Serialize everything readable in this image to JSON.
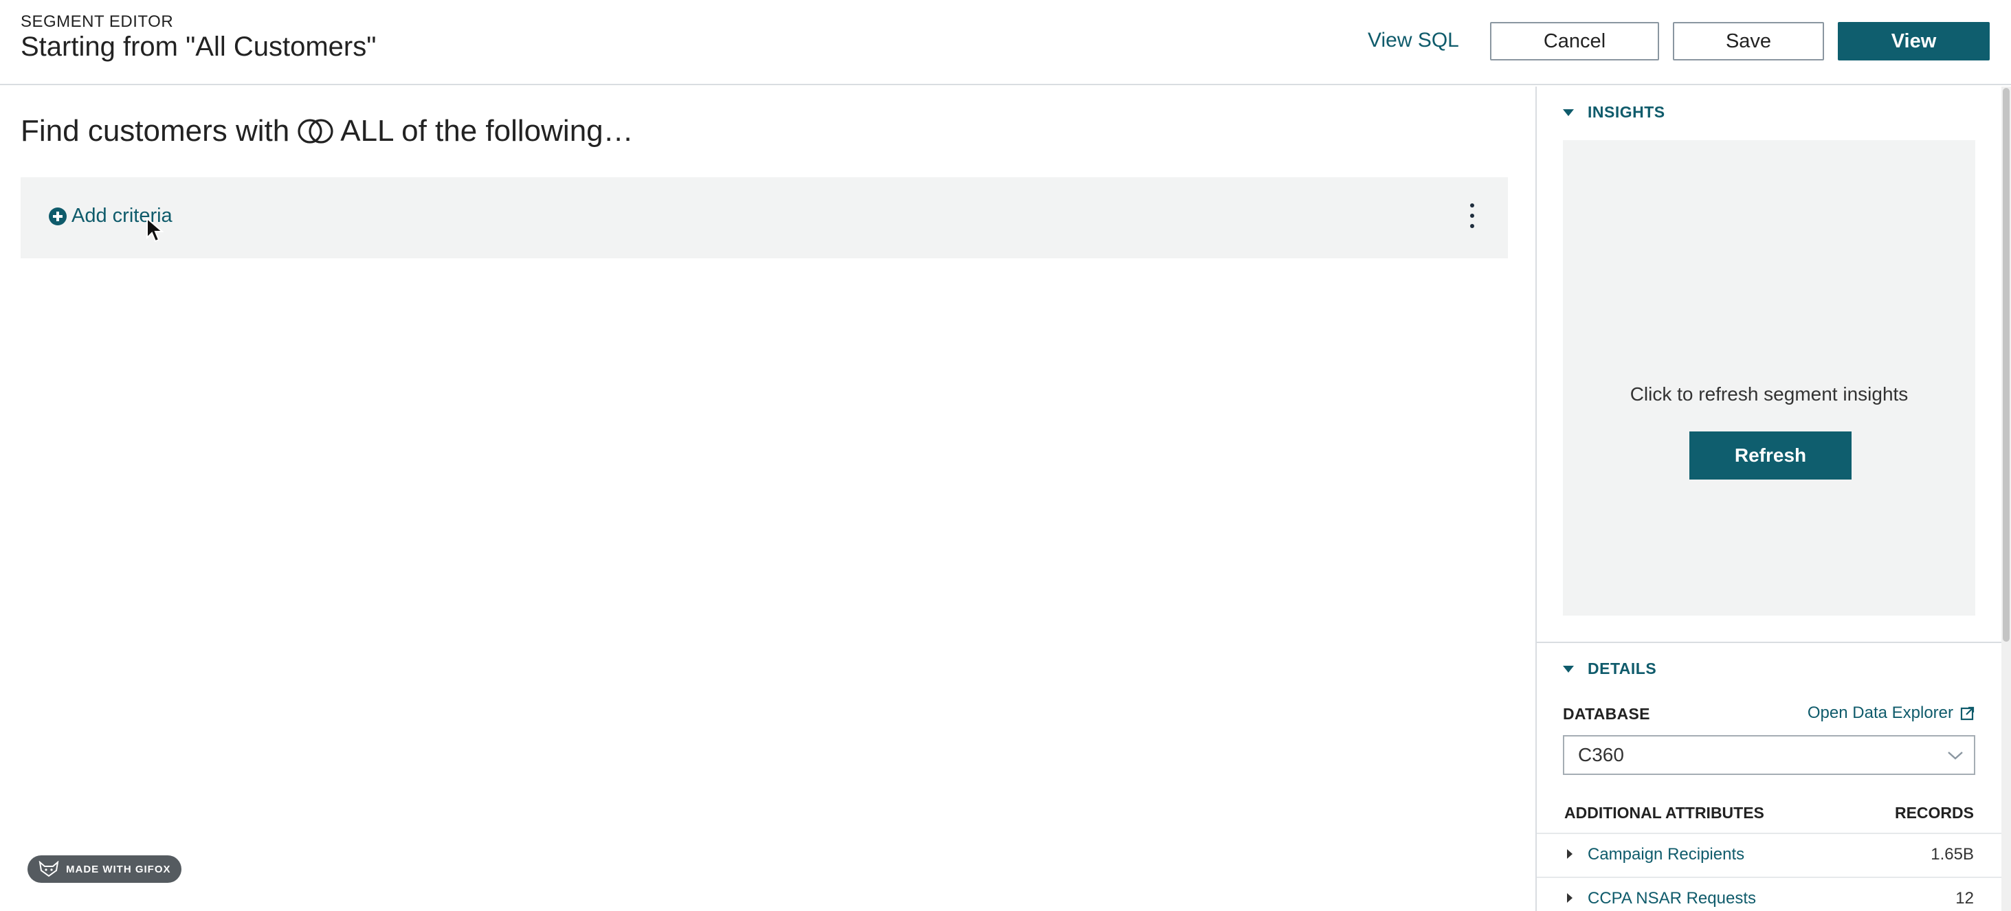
{
  "header": {
    "eyebrow": "SEGMENT EDITOR",
    "title": "Starting from \"All Customers\"",
    "view_sql": "View SQL",
    "cancel": "Cancel",
    "save": "Save",
    "view": "View"
  },
  "main": {
    "find_prefix": "Find customers with",
    "find_suffix": "ALL of the following…",
    "add_criteria": "Add criteria"
  },
  "watermark": "MADE WITH GIFOX",
  "panel": {
    "insights": {
      "heading": "INSIGHTS",
      "message": "Click to refresh segment insights",
      "refresh": "Refresh"
    },
    "details": {
      "heading": "DETAILS",
      "database_label": "DATABASE",
      "open_explorer": "Open Data Explorer",
      "database_value": "C360",
      "attributes_label": "ADDITIONAL ATTRIBUTES",
      "records_label": "RECORDS",
      "attributes": [
        {
          "name": "Campaign Recipients",
          "records": "1.65B"
        },
        {
          "name": "CCPA NSAR Requests",
          "records": "12"
        }
      ]
    }
  },
  "colors": {
    "accent": "#0f5e6e",
    "link": "#0f5b6b",
    "panel_bg": "#f2f3f3"
  },
  "icons": [
    "venn-all-icon",
    "plus-circle-icon",
    "kebab-menu-icon",
    "mouse-cursor-icon",
    "caret-down-icon",
    "external-link-icon",
    "chevron-down-icon",
    "caret-right-icon",
    "gifox-fox-icon"
  ]
}
